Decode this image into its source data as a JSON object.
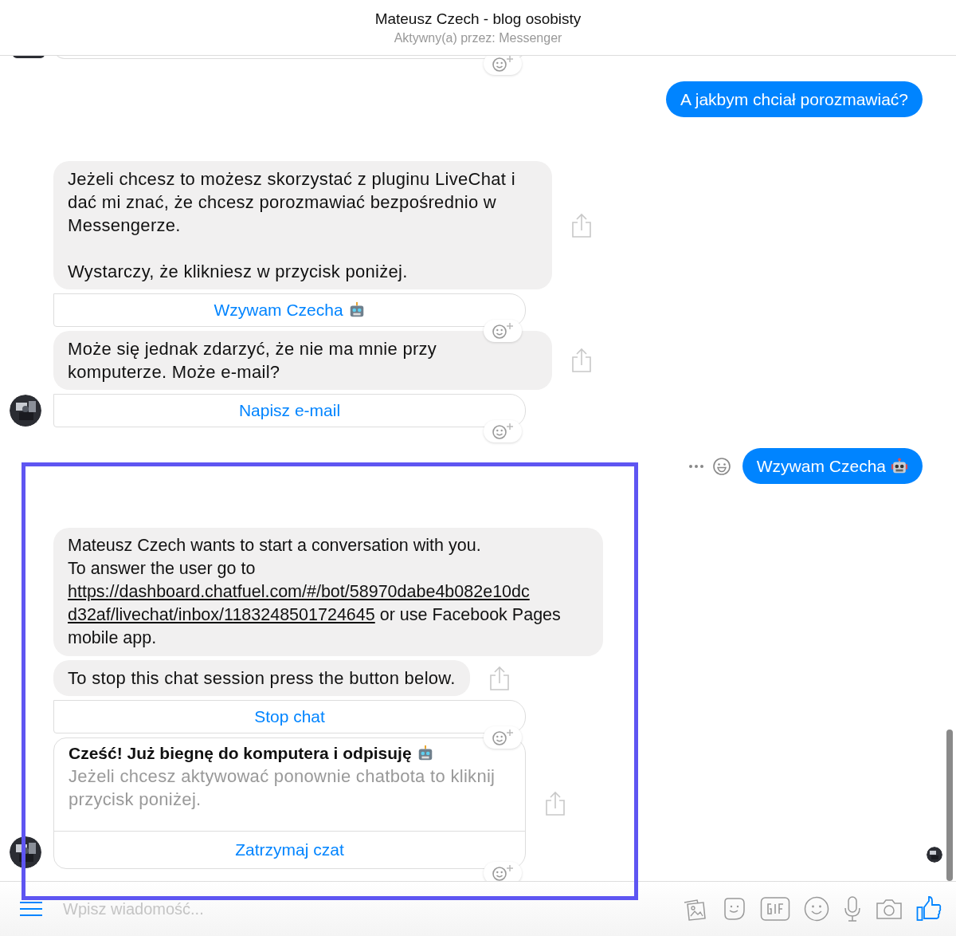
{
  "header": {
    "title": "Mateusz Czech - blog osobisty",
    "subtitle": "Aktywny(a) przez: Messenger"
  },
  "messages": [
    {
      "kind": "outgoing",
      "text": "A jakbym chciał porozmawiać?"
    },
    {
      "kind": "incoming",
      "segments": [
        {
          "kind": "text",
          "text": "Jeżeli chcesz to możesz skorzystać z pluginu LiveChat i dać mi znać, że chcesz porozmawiać bezpośrednio w Messengerze.\n\nWystarczy, że klikniesz w przycisk poniżej."
        }
      ],
      "share_button": true
    },
    {
      "kind": "button",
      "label": "Wzywam Czecha",
      "robot": true,
      "reaction_button": true
    },
    {
      "kind": "incoming",
      "segments": [
        {
          "kind": "text",
          "text": "Może się jednak zdarzyć, że nie ma mnie przy komputerze. Może e-mail?"
        }
      ],
      "share_button": true
    },
    {
      "kind": "button",
      "label": "Napisz e-mail",
      "reaction_button": true,
      "avatar": true
    },
    {
      "kind": "outgoing",
      "text": "Wzywam Czecha",
      "robot": true,
      "actions": true
    },
    {
      "kind": "incoming",
      "segments": [
        {
          "kind": "text",
          "text": "Mateusz Czech wants to start a conversation with you.\nTo answer the user go to "
        },
        {
          "kind": "link",
          "text": "https://dashboard.chatfuel.com/#/bot/58970dabe4b082e10dc"
        },
        {
          "kind": "link",
          "text": "d32af/livechat/inbox/1183248501724645"
        },
        {
          "kind": "text",
          "text": " or use Facebook Pages mobile app."
        }
      ]
    },
    {
      "kind": "incoming",
      "segments": [
        {
          "kind": "text",
          "text": "To stop this chat session press the button below."
        }
      ],
      "share_button": true
    },
    {
      "kind": "button",
      "label": "Stop chat",
      "reaction_button": true
    },
    {
      "kind": "card",
      "title": "Cześć! Już biegnę do komputera i odpisuję",
      "robot": true,
      "subtitle": "Jeżeli chcesz aktywować ponownie chatbota to kliknij przycisk poniżej.",
      "button": "Zatrzymaj czat",
      "share_button": true,
      "reaction_button": true,
      "avatar": true
    }
  ],
  "composer": {
    "placeholder": "Wpisz wiadomość..."
  }
}
